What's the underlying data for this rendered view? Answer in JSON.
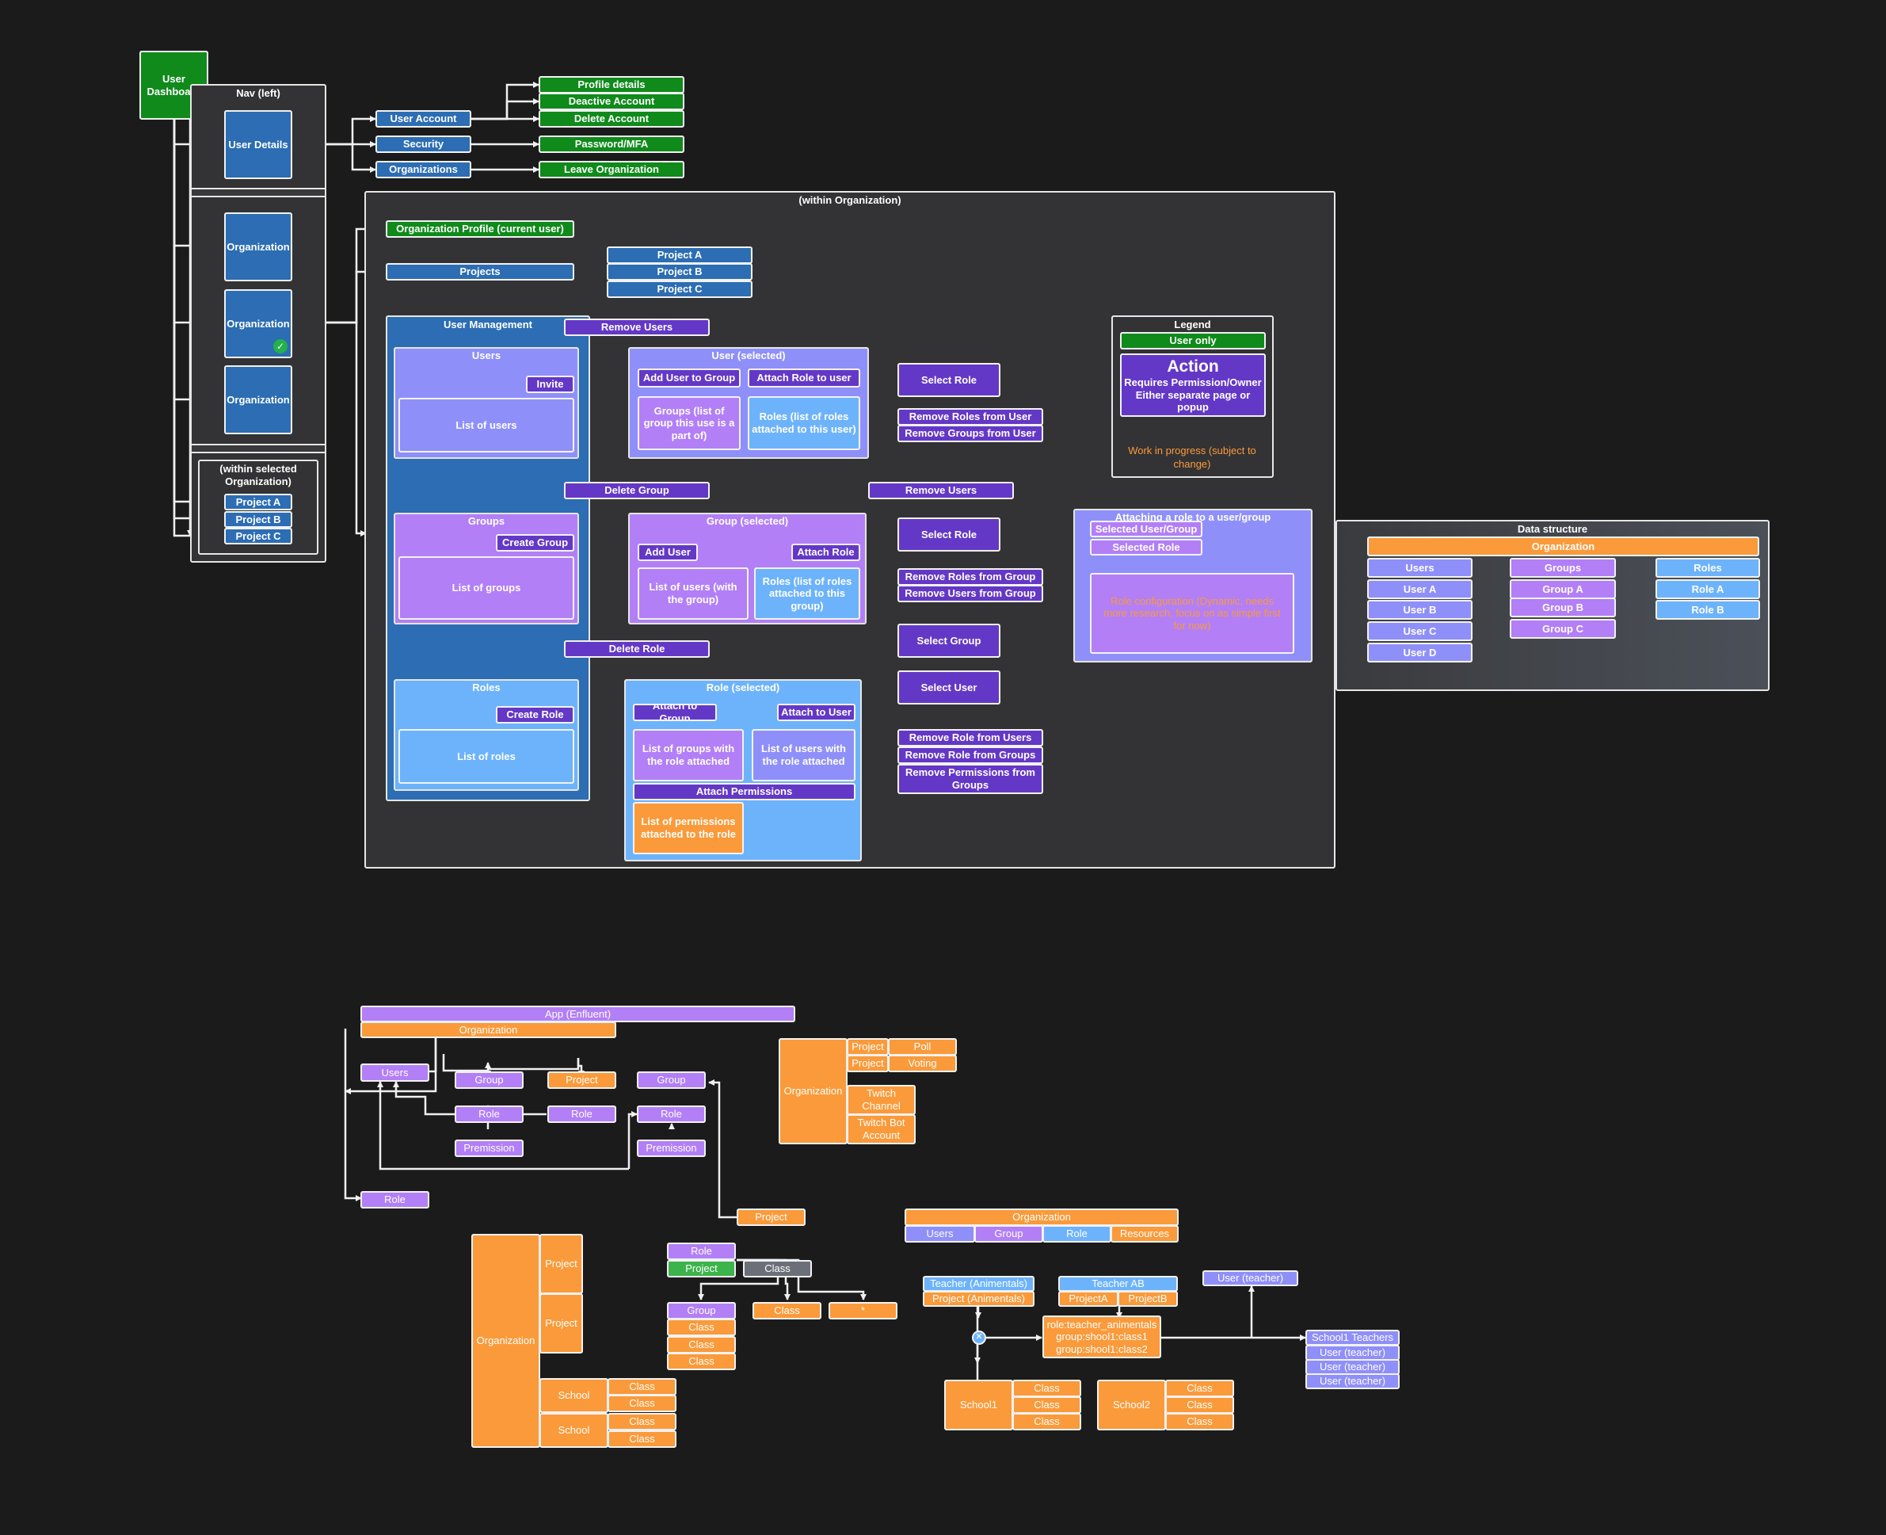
{
  "top": {
    "user_dashboard": "User Dashboard",
    "nav_title": "Nav (left)",
    "user_details": "User Details",
    "organization": "Organization",
    "within_selected_org": "(within selected Organization)",
    "project_a": "Project A",
    "project_b": "Project B",
    "project_c": "Project C",
    "user_account": "User Account",
    "security": "Security",
    "organizations": "Organizations",
    "profile_details": "Profile details",
    "deactive_account": "Deactive Account",
    "delete_account": "Delete Account",
    "password_mfa": "Password/MFA",
    "leave_organization": "Leave Organization"
  },
  "org": {
    "title": "(within Organization)",
    "org_profile": "Organization Profile (current user)",
    "projects": "Projects",
    "user_management": "User Management",
    "users": "Users",
    "invite": "Invite",
    "list_of_users": "List of users",
    "groups": "Groups",
    "create_group": "Create Group",
    "list_of_groups": "List of groups",
    "roles": "Roles",
    "create_role": "Create Role",
    "list_of_roles": "List of roles",
    "remove_users": "Remove Users",
    "delete_group": "Delete Group",
    "delete_role": "Delete Role",
    "user_selected": "User (selected)",
    "add_user_to_group": "Add User to Group",
    "attach_role_to_user": "Attach Role to user",
    "groups_list_user": "Groups (list of group this use is a part of)",
    "roles_list_user": "Roles (list of roles attached to this user)",
    "group_selected": "Group (selected)",
    "add_user": "Add User",
    "attach_role": "Attach Role",
    "list_users_group": "List of users (with the group)",
    "roles_list_group": "Roles (list of roles attached to this group)",
    "role_selected": "Role (selected)",
    "attach_to_group": "Attach to Group",
    "attach_to_user": "Attach to User",
    "groups_with_role": "List of groups with the role attached",
    "users_with_role": "List of users with the role attached",
    "attach_permissions": "Attach Permissions",
    "perm_list": "List of permissions attached to the role",
    "select_role": "Select Role",
    "remove_roles_from_user": "Remove Roles from User",
    "remove_groups_from_user": "Remove Groups from User",
    "remove_roles_from_group": "Remove Roles from Group",
    "remove_users_from_group": "Remove Users from Group",
    "select_group": "Select Group",
    "select_user": "Select User",
    "remove_role_from_users": "Remove Role from Users",
    "remove_role_from_groups": "Remove Role from Groups",
    "remove_perms_from_groups": "Remove Permissions from Groups",
    "attaching_title": "Attaching a role to a user/group",
    "selected_user_group": "Selected User/Group",
    "selected_role": "Selected Role",
    "attaching_note": "Role configuration (Dynamic, needs more research, focus on as simple first for now)"
  },
  "legend": {
    "title": "Legend",
    "user_only": "User only",
    "action": "Action",
    "action_desc": "Requires Permission/Owner Either separate page or popup",
    "wip": "Work in progress (subject to change)"
  },
  "ds": {
    "title": "Data structure",
    "organization": "Organization",
    "users": "Users",
    "groups": "Groups",
    "roles": "Roles",
    "user_a": "User A",
    "user_b": "User B",
    "user_c": "User C",
    "user_d": "User D",
    "group_a": "Group A",
    "group_b": "Group B",
    "group_c": "Group C",
    "role_a": "Role A",
    "role_b": "Role B"
  },
  "bottom": {
    "app": "App (Enfluent)",
    "organization": "Organization",
    "users": "Users",
    "group": "Group",
    "project": "Project",
    "role": "Role",
    "premission": "Premission",
    "poll": "Poll",
    "voting": "Voting",
    "twitch_channel": "Twitch Channel",
    "twitch_bot": "Twitch Bot Account",
    "resources": "Resources",
    "school": "School",
    "class": "Class",
    "star": "*",
    "teacher_animentals": "Teacher (Animentals)",
    "project_animentals": "Project (Animentals)",
    "teacher_ab": "Teacher AB",
    "project_a": "ProjectA",
    "project_b": "ProjectB",
    "user_teacher": "User (teacher)",
    "role_teacher_line1": "role:teacher_animentals",
    "role_teacher_line2": "group:shool1:class1",
    "role_teacher_line3": "group:shool1:class2",
    "school1_teachers": "School1 Teachers",
    "school1": "School1",
    "school2": "School2"
  },
  "colors": {
    "background": "#1b1b1c",
    "user_only_green": "#0f8a1b",
    "nav_blue": "#2c6db3",
    "action_purple": "#6438c6",
    "user_lavender": "#8f8ffa",
    "group_violet": "#b27ff7",
    "role_sky": "#6db3fb",
    "orange": "#fa9a3a",
    "container_grey": "#333335"
  },
  "icons": {
    "selected": "check-circle-icon",
    "junction": "cross-circle-icon"
  }
}
